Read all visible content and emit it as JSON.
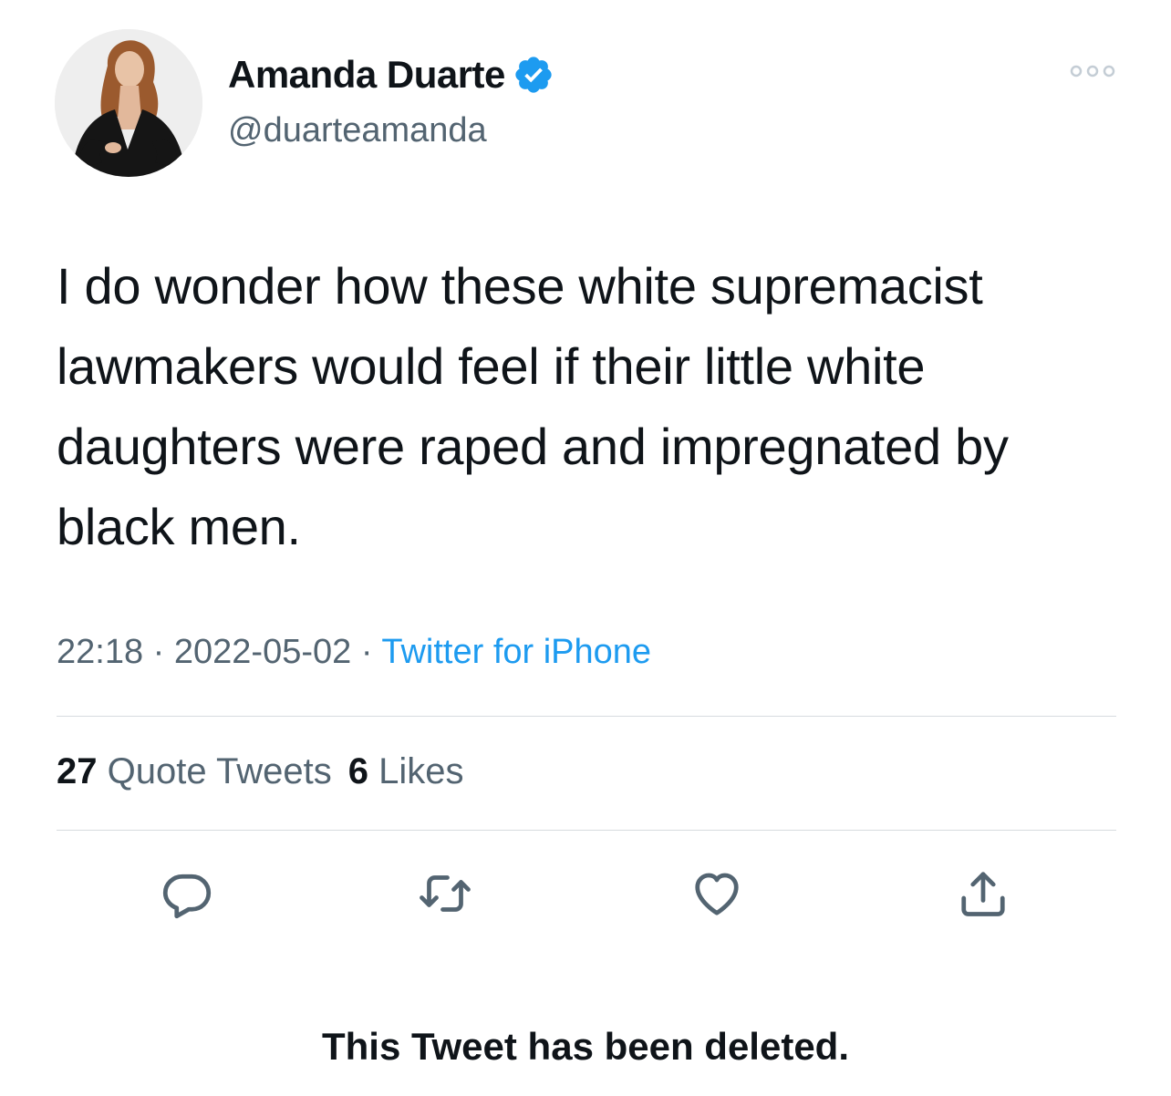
{
  "author": {
    "display_name": "Amanda Duarte",
    "handle": "@duarteamanda",
    "verified": true
  },
  "tweet": {
    "text": "I do wonder how these white supremacist lawmakers would feel if their little white daughters were raped and impregnated by black men.",
    "time": "22:18",
    "separator": "·",
    "date": "2022-05-02",
    "source": "Twitter for iPhone"
  },
  "stats": {
    "quote_tweets_count": "27",
    "quote_tweets_label": "Quote Tweets",
    "likes_count": "6",
    "likes_label": "Likes"
  },
  "actions": [
    "reply-icon",
    "retweet-icon",
    "like-icon",
    "share-icon"
  ],
  "footer": {
    "deleted_notice": "This Tweet has been deleted."
  },
  "colors": {
    "verified": "#1d9bf0",
    "secondary_text": "#536471",
    "link": "#1d9bf0"
  }
}
